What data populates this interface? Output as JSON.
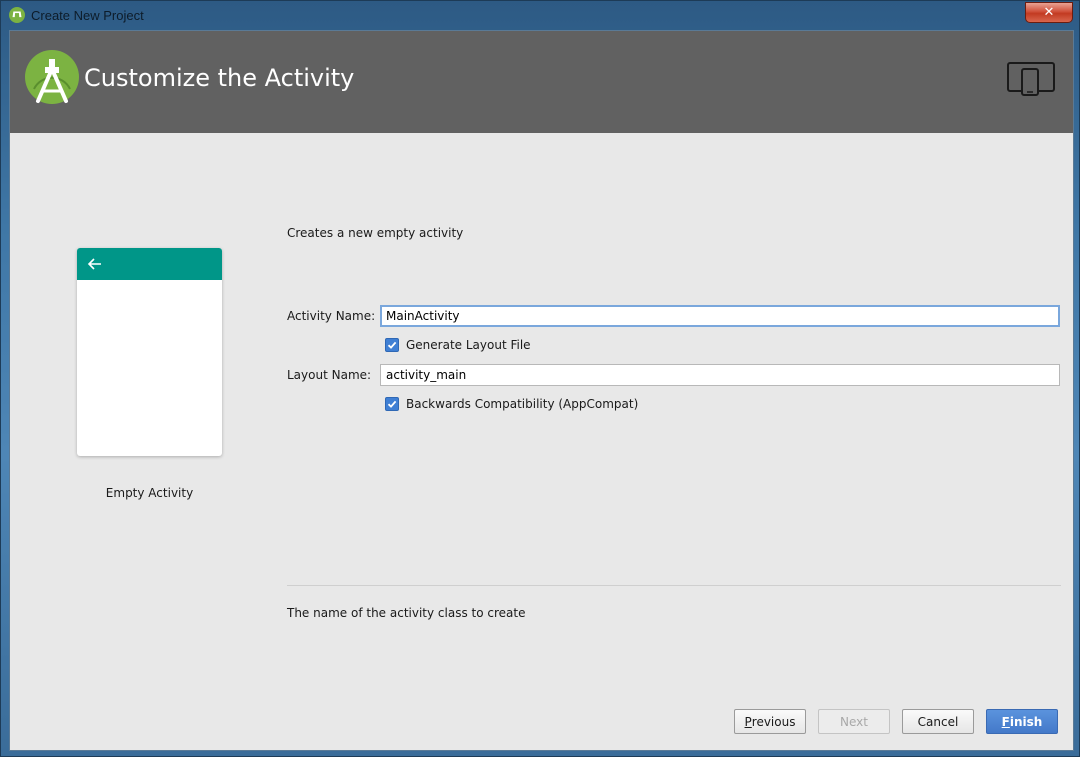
{
  "window": {
    "title": "Create New Project",
    "close_label": "✕"
  },
  "header": {
    "title": "Customize the Activity"
  },
  "template": {
    "name": "Empty Activity",
    "toolbar_color": "#009688"
  },
  "form": {
    "description": "Creates a new empty activity",
    "activity_name_label": "Activity Name:",
    "activity_name_value": "MainActivity",
    "generate_layout_label": "Generate Layout File",
    "generate_layout_checked": true,
    "layout_name_label": "Layout Name:",
    "layout_name_value": "activity_main",
    "backwards_compat_label": "Backwards Compatibility (AppCompat)",
    "backwards_compat_checked": true
  },
  "help": {
    "text": "The name of the activity class to create"
  },
  "buttons": {
    "previous_mnemonic": "P",
    "previous_rest": "revious",
    "next": "Next",
    "cancel": "Cancel",
    "finish_mnemonic": "F",
    "finish_rest": "inish"
  },
  "colors": {
    "header_bg": "#616161",
    "accent": "#4479c9",
    "android_green": "#7cb342"
  }
}
